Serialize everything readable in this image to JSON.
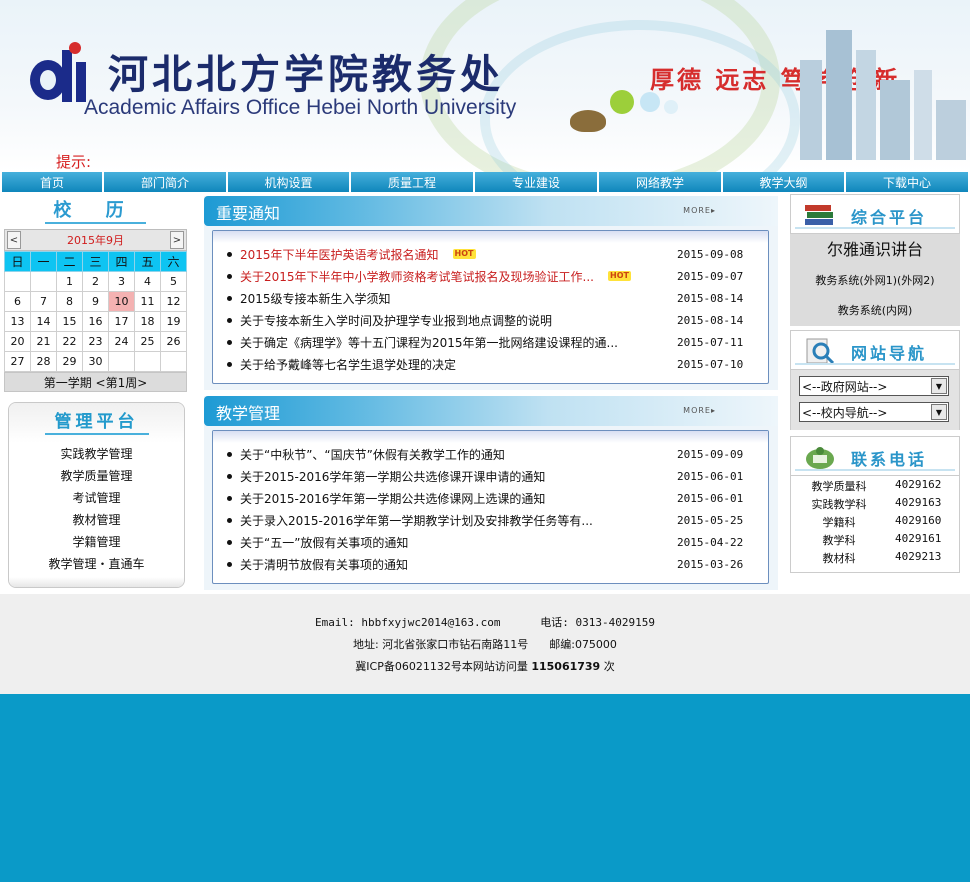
{
  "header": {
    "title_cn": "河北北方学院教务处",
    "title_en": "Academic Affairs Office Hebei North University",
    "motto": "厚德 远志 笃学 创新",
    "hint_label": "提示:"
  },
  "nav": {
    "items": [
      "首页",
      "部门简介",
      "机构设置",
      "质量工程",
      "专业建设",
      "网络教学",
      "教学大纲",
      "下载中心"
    ]
  },
  "calendar": {
    "title": "校 历",
    "month_label": "2015年9月",
    "prev": "<",
    "next": ">",
    "weekdays": [
      "日",
      "一",
      "二",
      "三",
      "四",
      "五",
      "六"
    ],
    "weeks": [
      [
        "",
        "",
        "1",
        "2",
        "3",
        "4",
        "5"
      ],
      [
        "6",
        "7",
        "8",
        "9",
        "10",
        "11",
        "12"
      ],
      [
        "13",
        "14",
        "15",
        "16",
        "17",
        "18",
        "19"
      ],
      [
        "20",
        "21",
        "22",
        "23",
        "24",
        "25",
        "26"
      ],
      [
        "27",
        "28",
        "29",
        "30",
        "",
        "",
        ""
      ]
    ],
    "today": "10",
    "term_label": "第一学期 <第1周>"
  },
  "mgmt": {
    "title": "管理平台",
    "items": [
      "实践教学管理",
      "教学质量管理",
      "考试管理",
      "教材管理",
      "学籍管理",
      "教学管理・直通车"
    ]
  },
  "notices": {
    "title": "重要通知",
    "more": "MORE▸",
    "items": [
      {
        "title": "2015年下半年医护英语考试报名通知",
        "date": "2015-09-08",
        "red": true,
        "hot": "HOT"
      },
      {
        "title": "关于2015年下半年中小学教师资格考试笔试报名及现场验证工作...",
        "date": "2015-09-07",
        "red": true,
        "hot": "HOT"
      },
      {
        "title": "2015级专接本新生入学须知",
        "date": "2015-08-14",
        "red": false,
        "hot": ""
      },
      {
        "title": "关于专接本新生入学时间及护理学专业报到地点调整的说明",
        "date": "2015-08-14",
        "red": false,
        "hot": ""
      },
      {
        "title": "关于确定《病理学》等十五门课程为2015年第一批网络建设课程的通...",
        "date": "2015-07-11",
        "red": false,
        "hot": ""
      },
      {
        "title": "关于给予戴峰等七名学生退学处理的决定",
        "date": "2015-07-10",
        "red": false,
        "hot": ""
      }
    ]
  },
  "teaching": {
    "title": "教学管理",
    "more": "MORE▸",
    "items": [
      {
        "title": "关于“中秋节”、“国庆节”休假有关教学工作的通知",
        "date": "2015-09-09"
      },
      {
        "title": "关于2015-2016学年第一学期公共选修课开课申请的通知",
        "date": "2015-06-01"
      },
      {
        "title": "关于2015-2016学年第一学期公共选修课网上选课的通知",
        "date": "2015-06-01"
      },
      {
        "title": "关于录入2015-2016学年第一学期教学计划及安排教学任务等有...",
        "date": "2015-05-25"
      },
      {
        "title": "关于“五一”放假有关事项的通知",
        "date": "2015-04-22"
      },
      {
        "title": "关于清明节放假有关事项的通知",
        "date": "2015-03-26"
      }
    ]
  },
  "platform": {
    "title": "综合平台",
    "line1": "尔雅通识讲台",
    "line2": "教务系统(外网1)(外网2)",
    "line3": "教务系统(内网)"
  },
  "site_nav": {
    "title": "网站导航",
    "select1": "<--政府网站-->",
    "select2": "<--校内导航-->"
  },
  "contact": {
    "title": "联系电话",
    "rows": [
      {
        "name": "教学质量科",
        "phone": "4029162"
      },
      {
        "name": "实践教学科",
        "phone": "4029163"
      },
      {
        "name": "学籍科",
        "phone": "4029160"
      },
      {
        "name": "教学科",
        "phone": "4029161"
      },
      {
        "name": "教材科",
        "phone": "4029213"
      }
    ]
  },
  "footer": {
    "email_label": "Email:",
    "email": "hbbfxyjwc2014@163.com",
    "phone_label": "电话:",
    "phone": "0313-4029159",
    "address": "地址: 河北省张家口市钻石南路11号",
    "postcode": "邮编:075000",
    "icp": "冀ICP备06021132号本网站访问量",
    "visits": "115061739",
    "visits_unit": "次"
  },
  "colors": {
    "nav_bg": "#0f86bb",
    "accent": "#2a9ad0",
    "hot_red": "#c81e1e",
    "page_bg": "#0a9ac8"
  }
}
